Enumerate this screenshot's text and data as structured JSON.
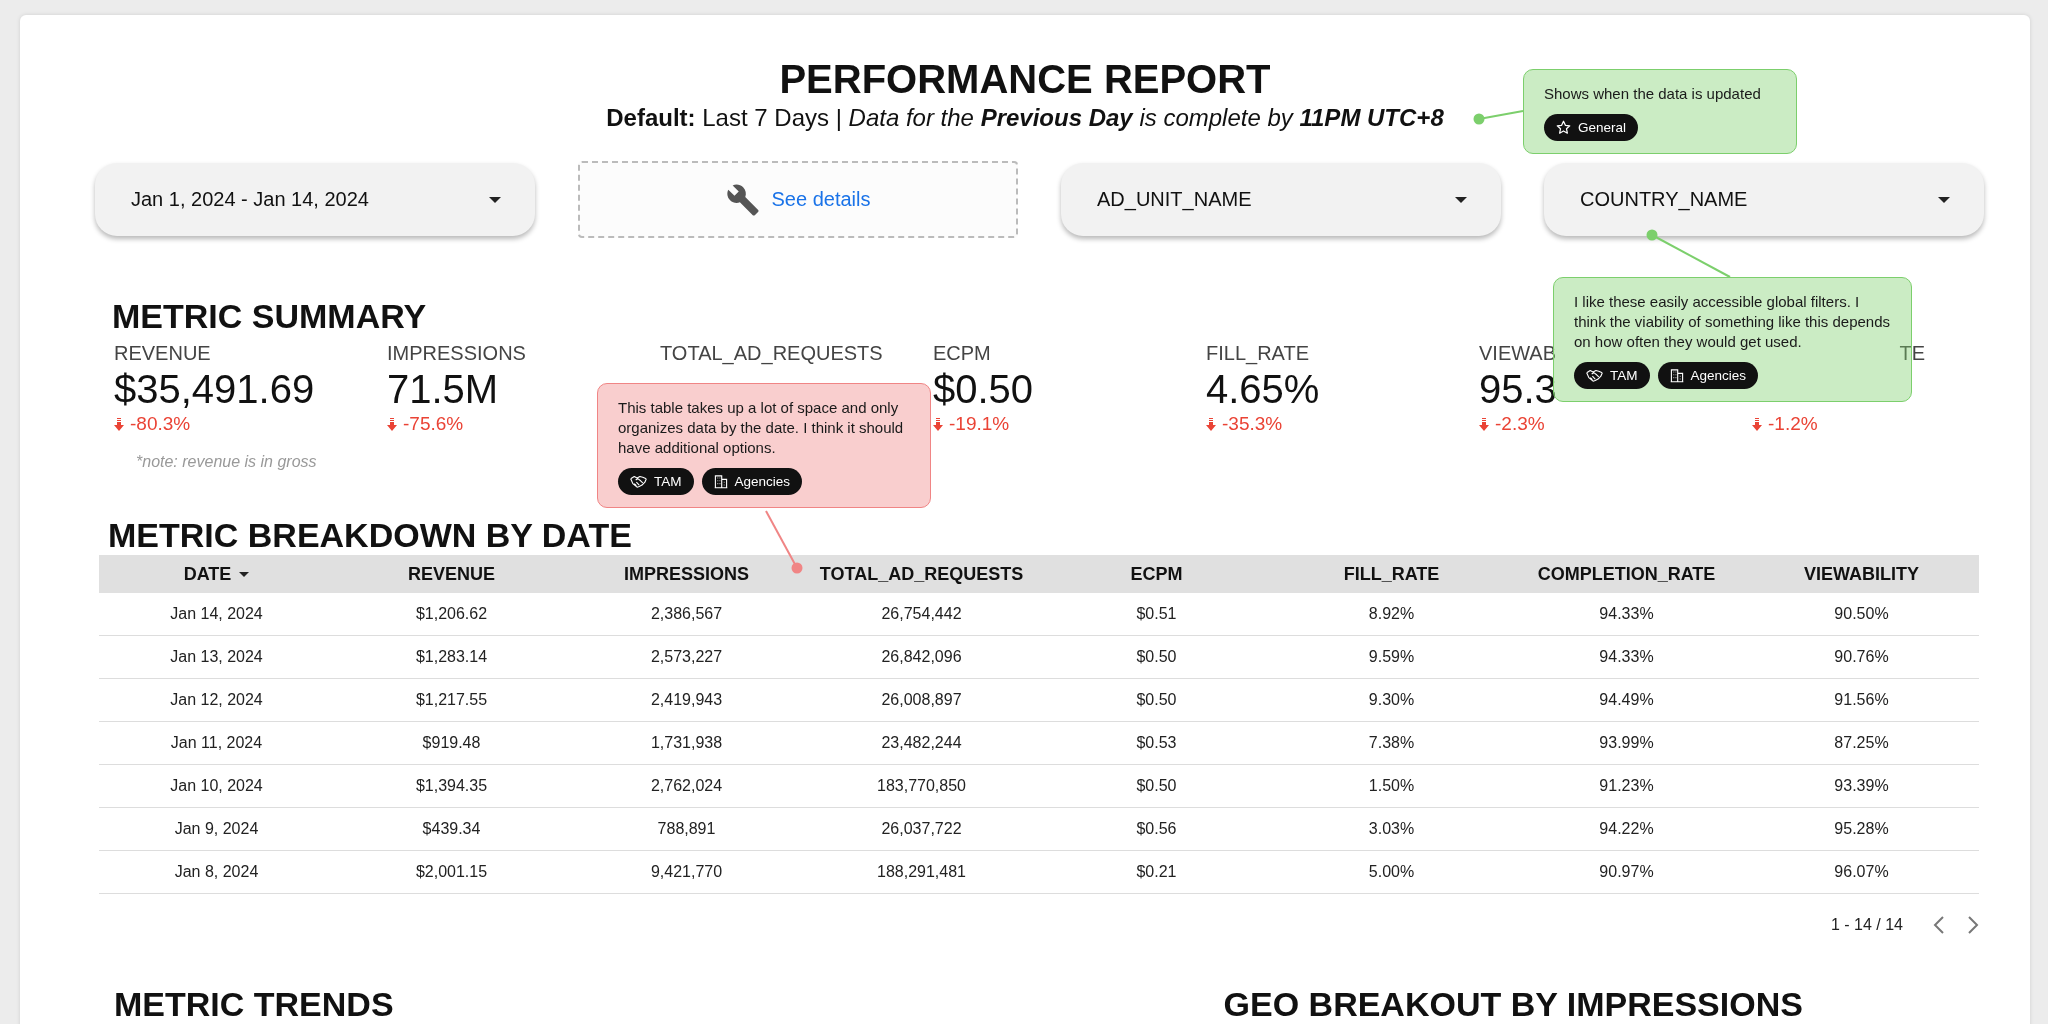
{
  "report": {
    "title": "PERFORMANCE REPORT",
    "subtitle": {
      "lead": "**Default:** Last 7 Days |",
      "completeness": "Data for the **Previous Day** is complete by **11PM UTC+8**"
    }
  },
  "filters": [
    {
      "kind": "dropdown",
      "label": "Jan 1, 2024 - Jan 14, 2024"
    },
    {
      "kind": "link",
      "label": "See details"
    },
    {
      "kind": "dropdown",
      "label": "AD_UNIT_NAME"
    },
    {
      "kind": "dropdown",
      "label": "COUNTRY_NAME"
    }
  ],
  "metric_summary": {
    "heading": "METRIC SUMMARY",
    "note": "*note: revenue is in gross",
    "metrics": [
      {
        "label": "REVENUE",
        "value": "$35,491.69",
        "change": "-80.3%"
      },
      {
        "label": "IMPRESSIONS",
        "value": "71.5M",
        "change": "-75.6%"
      },
      {
        "label": "TOTAL_AD_REQUESTS"
      },
      {
        "label": "ECPM",
        "value": "$0.50",
        "change": "-19.1%"
      },
      {
        "label": "FILL_RATE",
        "value": "4.65%",
        "change": "-35.3%"
      },
      {
        "label": "VIEWAB",
        "value": "95.3",
        "change": "-2.3%"
      },
      {
        "label": "TE",
        "change": "-1.2%"
      }
    ]
  },
  "breakdown": {
    "heading": "METRIC BREAKDOWN BY DATE",
    "columns": [
      {
        "label": "DATE",
        "sorted": true
      },
      {
        "label": "REVENUE",
        "sorted": false
      },
      {
        "label": "IMPRESSIONS",
        "sorted": false
      },
      {
        "label": "TOTAL_AD_REQUESTS",
        "sorted": false
      },
      {
        "label": "ECPM",
        "sorted": false
      },
      {
        "label": "FILL_RATE",
        "sorted": false
      },
      {
        "label": "COMPLETION_RATE",
        "sorted": false
      },
      {
        "label": "VIEWABILITY",
        "sorted": false
      }
    ],
    "rows": [
      [
        "Jan 14, 2024",
        "$1,206.62",
        "2,386,567",
        "26,754,442",
        "$0.51",
        "8.92%",
        "94.33%",
        "90.50%"
      ],
      [
        "Jan 13, 2024",
        "$1,283.14",
        "2,573,227",
        "26,842,096",
        "$0.50",
        "9.59%",
        "94.33%",
        "90.76%"
      ],
      [
        "Jan 12, 2024",
        "$1,217.55",
        "2,419,943",
        "26,008,897",
        "$0.50",
        "9.30%",
        "94.49%",
        "91.56%"
      ],
      [
        "Jan 11, 2024",
        "$919.48",
        "1,731,938",
        "23,482,244",
        "$0.53",
        "7.38%",
        "93.99%",
        "87.25%"
      ],
      [
        "Jan 10, 2024",
        "$1,394.35",
        "2,762,024",
        "183,770,850",
        "$0.50",
        "1.50%",
        "91.23%",
        "93.39%"
      ],
      [
        "Jan 9, 2024",
        "$439.34",
        "788,891",
        "26,037,722",
        "$0.56",
        "3.03%",
        "94.22%",
        "95.28%"
      ],
      [
        "Jan 8, 2024",
        "$2,001.15",
        "9,421,770",
        "188,291,481",
        "$0.21",
        "5.00%",
        "90.97%",
        "96.07%"
      ]
    ],
    "pagination": "1 - 14 / 14"
  },
  "sections": [
    "METRIC TRENDS",
    "GEO BREAKOUT BY IMPRESSIONS"
  ],
  "comments": [
    {
      "text": "Shows when the data is updated",
      "color": "#7ccf6c",
      "tags": [
        {
          "kind": "general",
          "label": "General"
        }
      ]
    },
    {
      "text": "I like these easily accessible global filters. I think the viability of something like this depends on how often they would get used.",
      "color": "#7ccf6c",
      "tags": [
        {
          "kind": "tam",
          "label": "TAM"
        },
        {
          "kind": "agencies",
          "label": "Agencies"
        }
      ]
    },
    {
      "text": "This table takes up a lot of space and only organizes data by the date. I think it should have additional options.",
      "color": "#f08585",
      "tags": [
        {
          "kind": "tam",
          "label": "TAM"
        },
        {
          "kind": "agencies",
          "label": "Agencies"
        }
      ]
    }
  ]
}
